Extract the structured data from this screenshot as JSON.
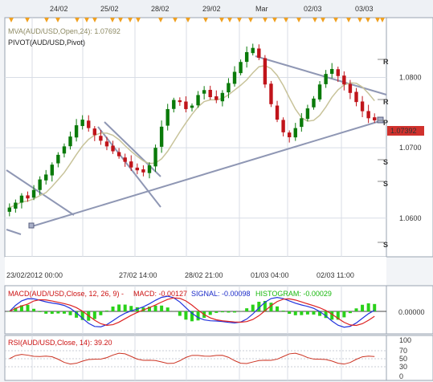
{
  "colors": {
    "background": "#ffffff",
    "grid": "#d8dde6",
    "up_candle": "#0a7a0a",
    "down_candle": "#c0141a",
    "mva_line": "#c8c39a",
    "trend_line": "#8f97b4",
    "macd_line": "#2233dd",
    "signal_line": "#dd2222",
    "histogram": "#2ad11a",
    "rsi_line": "#cc3322",
    "current_price_box": "#d0312d",
    "event_marker": "#f0a020"
  },
  "top_axis": {
    "labels": [
      "24/02",
      "25/02",
      "28/02",
      "29/02",
      "Mar",
      "02/03",
      "03/03"
    ]
  },
  "bottom_axis": {
    "labels": [
      "23/02/2012 00:00",
      "27/02 14:00",
      "28/02 21:00",
      "01/03 04:00",
      "02/03 11:00"
    ]
  },
  "main_panel": {
    "mva_label": "MVA(AUD/USD,Open,24): 1.07692",
    "pivot_label": "PIVOT(AUD/USD,Pivot)",
    "pivot_markers": [
      "R",
      "R",
      "P",
      "S",
      "S",
      "S"
    ],
    "current_price": "1.07392"
  },
  "macd_panel": {
    "label_prefix": "MACD(AUD/USD,Close, 12, 26, 9) -",
    "macd_text": "MACD: -0.00127",
    "signal_text": "SIGNAL: -0.00098",
    "histogram_text": "HISTOGRAM: -0.00029",
    "zero_label": "0.00000"
  },
  "rsi_panel": {
    "label": "RSI(AUD/USD,Close, 14): 39.20",
    "levels": [
      "100",
      "70",
      "50",
      "30",
      "0"
    ]
  },
  "chart_data": [
    {
      "type": "candlestick",
      "title": "AUD/USD",
      "y_tick_labels": [
        "1.0800",
        "1.0700",
        "1.0600"
      ],
      "ylim": [
        1.0545,
        1.0885
      ],
      "grid": true,
      "close_approx": [
        1.0615,
        1.0622,
        1.0632,
        1.0628,
        1.064,
        1.0655,
        1.0662,
        1.0676,
        1.069,
        1.0702,
        1.0716,
        1.0732,
        1.074,
        1.0728,
        1.0718,
        1.071,
        1.0702,
        1.0695,
        1.0688,
        1.068,
        1.0672,
        1.0668,
        1.0665,
        1.0675,
        1.07,
        1.073,
        1.0755,
        1.0768,
        1.0765,
        1.0755,
        1.076,
        1.0775,
        1.0782,
        1.0772,
        1.0768,
        1.0778,
        1.0792,
        1.0808,
        1.0822,
        1.0836,
        1.0842,
        1.0828,
        1.079,
        1.0762,
        1.074,
        1.0722,
        1.0715,
        1.0728,
        1.0742,
        1.0756,
        1.077,
        1.079,
        1.0805,
        1.0812,
        1.0802,
        1.079,
        1.0778,
        1.0765,
        1.0752,
        1.0742,
        1.0739
      ],
      "mva_line": {
        "name": "MVA(AUD/USD,Open,24)",
        "last_value": 1.07692
      },
      "current_price": 1.07392
    },
    {
      "type": "macd",
      "series": [
        {
          "name": "MACD",
          "last_value": -0.00127
        },
        {
          "name": "SIGNAL",
          "last_value": -0.00098
        },
        {
          "name": "HISTOGRAM",
          "last_value": -0.00029
        }
      ]
    },
    {
      "type": "line",
      "series": [
        {
          "name": "RSI",
          "last_value": 39.2
        }
      ],
      "ylim": [
        0,
        100
      ],
      "levels": [
        100,
        70,
        50,
        30,
        0
      ]
    }
  ]
}
